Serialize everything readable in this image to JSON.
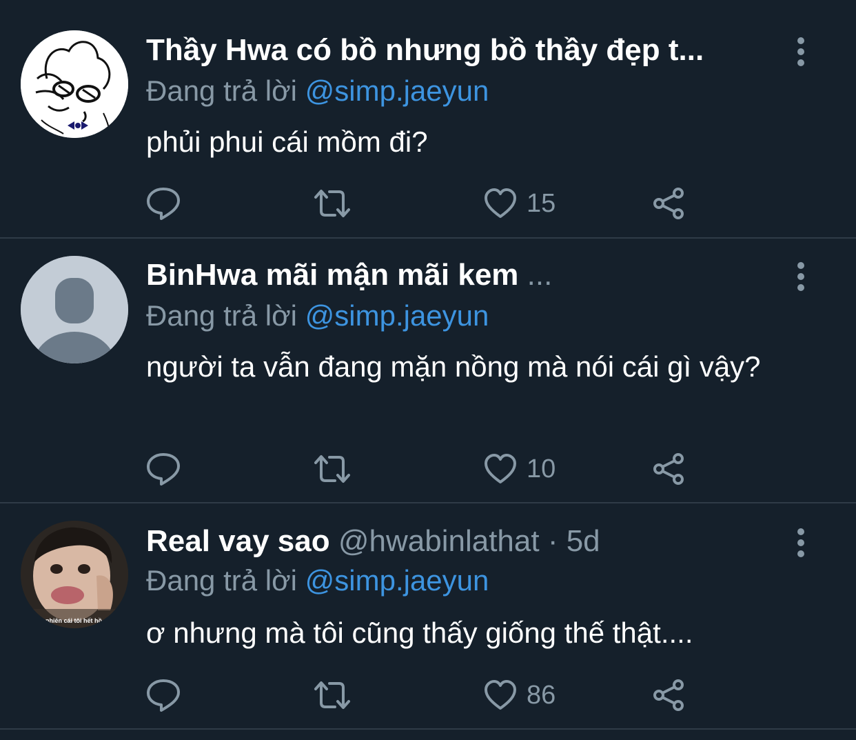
{
  "reply_prefix": "Đang trả lời",
  "tweets": [
    {
      "name": "Thầy Hwa có bồ nhưng bồ thầy đẹp t...",
      "name_suffix": "",
      "handle": "",
      "mention": "@simp.jaeyun",
      "text": "phủi phui cái mồm đi?",
      "likes": "15",
      "avatar_style": "drawing"
    },
    {
      "name": "BinHwa mãi mận mãi kem",
      "name_suffix": "...",
      "handle": "",
      "mention": "@simp.jaeyun",
      "text": "người ta vẫn đang mặn nồng mà nói cái gì vậy?",
      "likes": "10",
      "avatar_style": "default"
    },
    {
      "name": "Real vay sao",
      "name_suffix": "",
      "handle": "@hwabinlathat · 5d",
      "mention": "@simp.jaeyun",
      "text": "ơ nhưng mà tôi cũng thấy giống thế thật....",
      "likes": "86",
      "avatar_style": "photo",
      "avatar_caption": "tự nhiên cái tôi hết hồ"
    }
  ],
  "icons": {
    "reply": "reply-icon",
    "retweet": "retweet-icon",
    "like": "heart-icon",
    "share": "share-icon",
    "more": "more-vertical-icon"
  },
  "colors": {
    "background": "#15202b",
    "divider": "#2f3b47",
    "muted": "#8899a6",
    "link": "#3d94e0",
    "text": "#ffffff"
  }
}
